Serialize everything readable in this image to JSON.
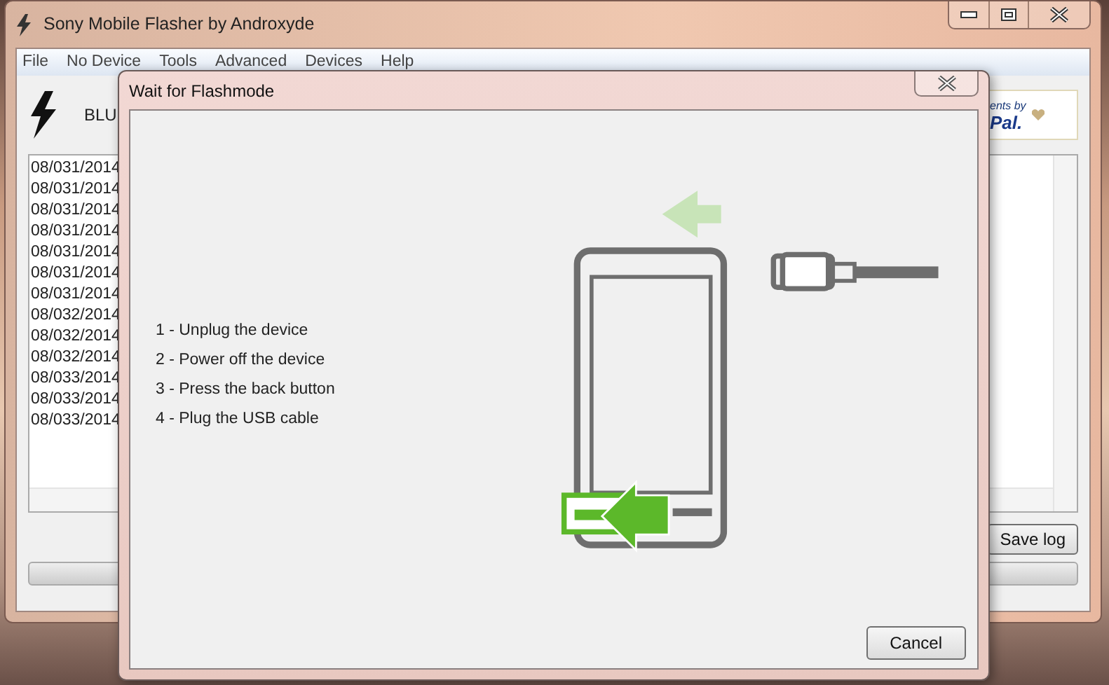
{
  "window": {
    "title": "Sony Mobile Flasher by Androxyde"
  },
  "menu": [
    "File",
    "No Device",
    "Tools",
    "Advanced",
    "Devices",
    "Help"
  ],
  "toolbar": {
    "label": "BLU",
    "donate_lines": [
      "ents by",
      "Pal."
    ]
  },
  "log": [
    "08/031/2014",
    "08/031/2014",
    "08/031/2014",
    "08/031/2014",
    "08/031/2014",
    "08/031/2014",
    "08/031/2014",
    "08/032/2014",
    "08/032/2014",
    "08/032/2014",
    "08/033/2014",
    "08/033/2014",
    "08/033/2014"
  ],
  "save_button": "Save log",
  "dialog": {
    "title": "Wait for Flashmode",
    "steps": [
      "1 - Unplug the device",
      "2 - Power off the device",
      "3 - Press the back button",
      "4 - Plug the USB cable"
    ],
    "cancel": "Cancel"
  }
}
